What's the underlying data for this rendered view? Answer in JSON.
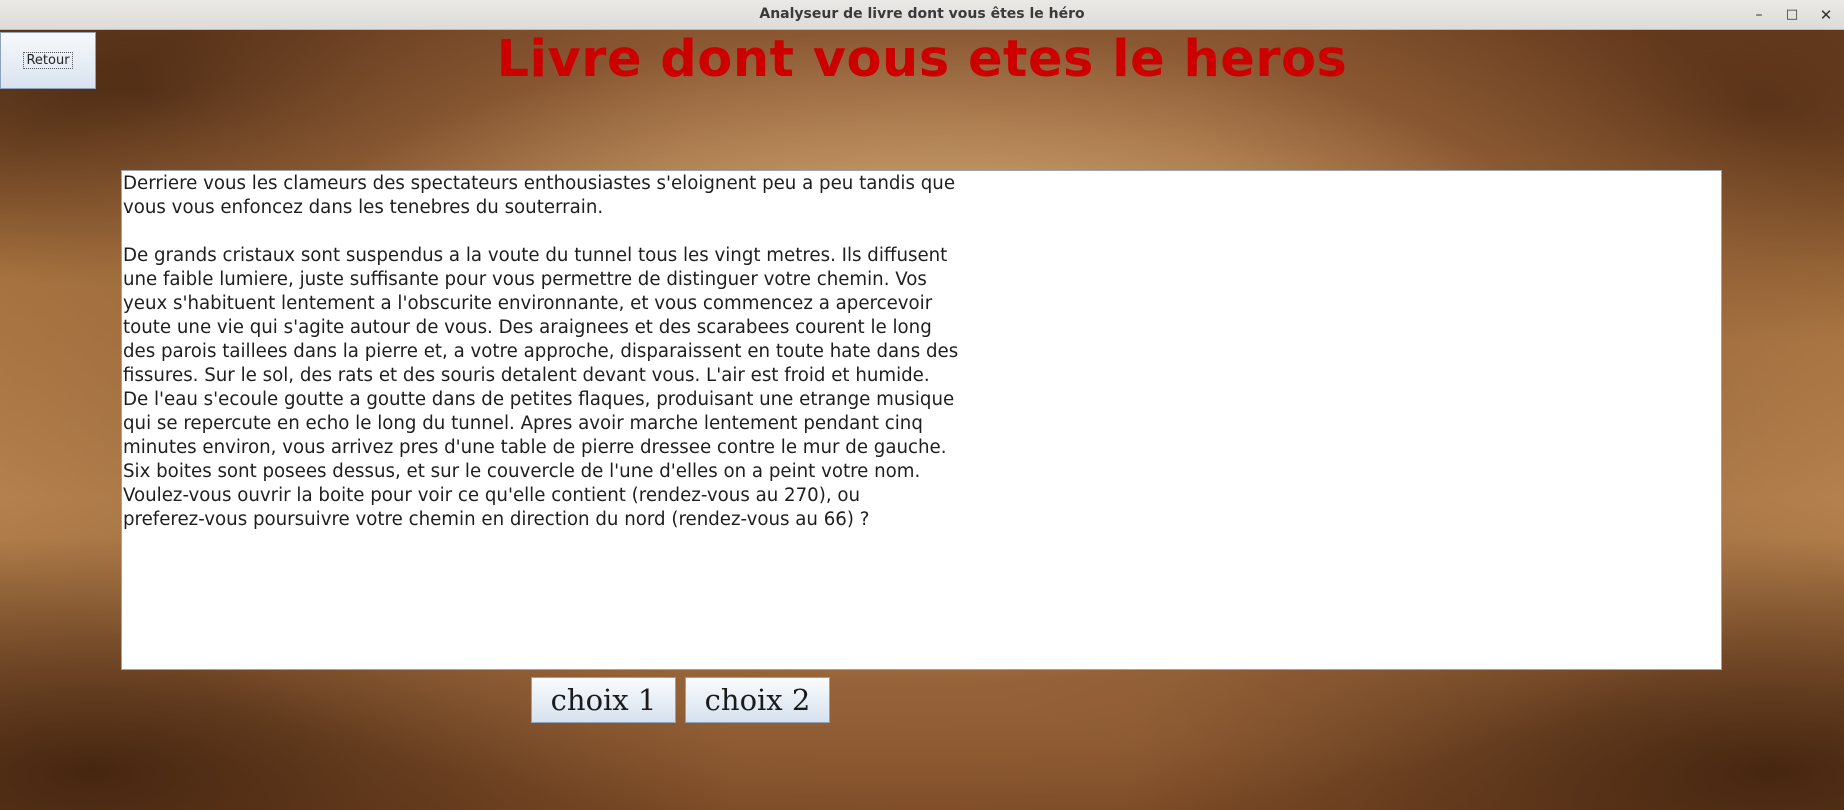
{
  "window": {
    "title": "Analyseur de livre dont vous êtes le héro",
    "minimize_glyph": "–",
    "maximize_glyph": "□",
    "close_glyph": "✕"
  },
  "toolbar": {
    "back_label": "Retour"
  },
  "main": {
    "heading": "Livre dont vous etes le heros",
    "story_text": "Derriere vous les clameurs des spectateurs enthousiastes s'eloignent peu a peu tandis que\nvous vous enfoncez dans les tenebres du souterrain.\n\nDe grands cristaux sont suspendus a la voute du tunnel tous les vingt metres. Ils diffusent\nune faible lumiere, juste suffisante pour vous permettre de distinguer votre chemin. Vos\nyeux s'habituent lentement a l'obscurite environnante, et vous commencez a apercevoir\ntoute une vie qui s'agite autour de vous. Des araignees et des scarabees courent le long\ndes parois taillees dans la pierre et, a votre approche, disparaissent en toute hate dans des\nfissures. Sur le sol, des rats et des souris detalent devant vous. L'air est froid et humide.\nDe l'eau s'ecoule goutte a goutte dans de petites flaques, produisant une etrange musique\nqui se repercute en echo le long du tunnel. Apres avoir marche lentement pendant cinq\nminutes environ, vous arrivez pres d'une table de pierre dressee contre le mur de gauche.\nSix boites sont posees dessus, et sur le couvercle de l'une d'elles on a peint votre nom.\nVoulez-vous ouvrir la boite pour voir ce qu'elle contient (rendez-vous au 270), ou\npreferez-vous poursuivre votre chemin en direction du nord (rendez-vous au 66) ?"
  },
  "choices": [
    {
      "label": "choix 1"
    },
    {
      "label": "choix 2"
    }
  ],
  "colors": {
    "heading": "#cc0000",
    "text_area_bg": "#ffffff",
    "button_gradient_top": "#fafcfe",
    "button_gradient_bottom": "#d6e1ee"
  }
}
